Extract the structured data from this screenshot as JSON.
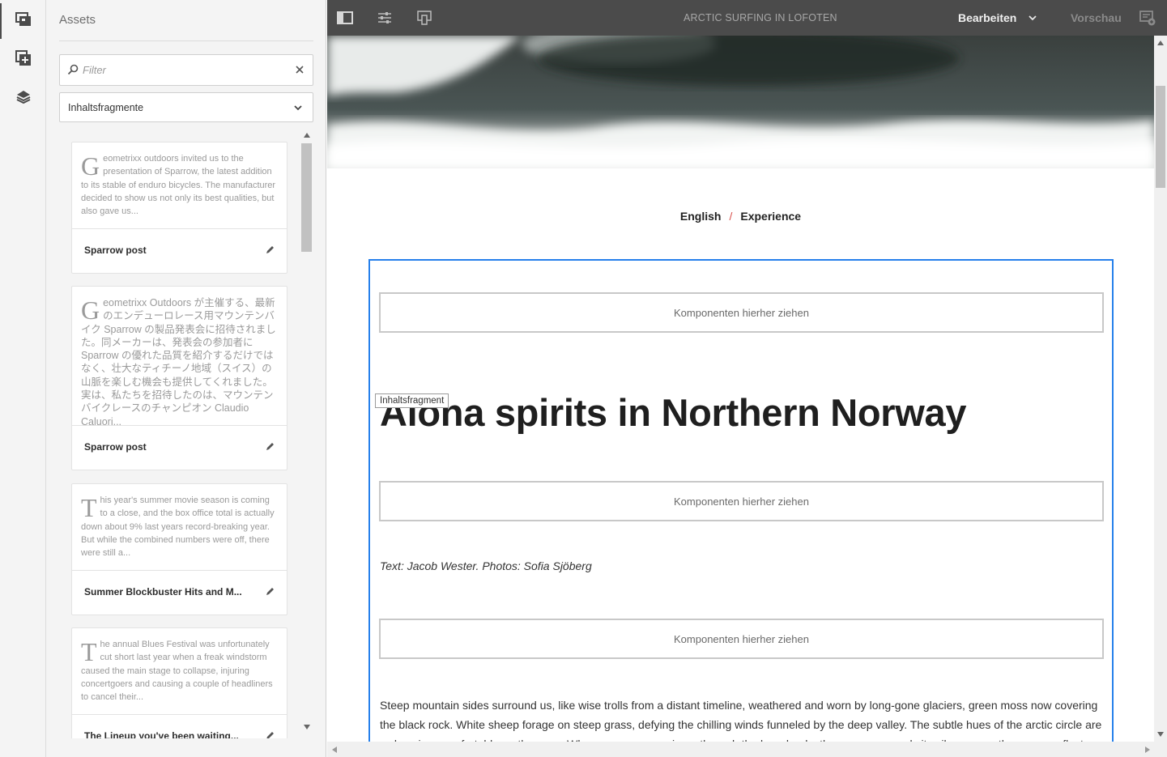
{
  "rail": {
    "items": [
      {
        "icon": "assets-icon"
      },
      {
        "icon": "components-icon"
      },
      {
        "icon": "content-tree-icon"
      }
    ]
  },
  "panel": {
    "title": "Assets",
    "filter_placeholder": "Filter",
    "type_select": "Inhaltsfragmente",
    "cards": [
      {
        "drop": "G",
        "excerpt": "eometrixx outdoors invited us to the presentation of Sparrow, the latest addition to its stable of enduro bicycles. The manufacturer decided to show us not only its best qualities, but also gave us...",
        "title": "Sparrow post"
      },
      {
        "drop": "G",
        "excerpt": "eometrixx Outdoors が主催する、最新のエンデューロレース用マウンテンバイク Sparrow の製品発表会に招待されました。同メーカーは、発表会の参加者に Sparrow の優れた品質を紹介するだけではなく、壮大なティチーノ地域（スイス）の山脈を楽しむ機会も提供してくれました。実は、私たちを招待したのは、マウンテン バイクレースのチャンピオン Claudio Caluori...",
        "title": "Sparrow post"
      },
      {
        "drop": "T",
        "excerpt": "his year's summer movie season is coming to a close, and the box office total is actually down about 9% last years record-breaking year. But while the combined numbers were off, there were still a...",
        "title": "Summer Blockbuster Hits and M..."
      },
      {
        "drop": "T",
        "excerpt": "he annual Blues Festival was unfortunately cut short last year when a freak windstorm caused the main stage to collapse, injuring concertgoers and causing a couple of headliners to cancel their...",
        "title": "The Lineup you've been waiting..."
      }
    ]
  },
  "topbar": {
    "page_title": "ARCTIC SURFING IN LOFOTEN",
    "mode": "Bearbeiten",
    "preview": "Vorschau"
  },
  "page": {
    "breadcrumb": [
      "English",
      "Experience"
    ],
    "breadcrumb_sep": "/",
    "dropzone_label": "Komponenten hierher ziehen",
    "fragment_tag": "Inhaltsfragment",
    "headline": "Aloha spirits in Northern Norway",
    "byline": "Text: Jacob Wester. Photos: Sofia Sjöberg",
    "body": "Steep mountain sides surround us, like wise trolls from a distant timeline, weathered and worn by long-gone glaciers, green moss now covering the black rock. White sheep forage on steep grass, defying the chilling winds funneled by the deep valley. The subtle hues of the arctic circle are welcoming, comfortable on the eyes. When rare sunrays pierce through the low clouds, the scenery reveals its vibrancy, as the waves reflect a"
  },
  "colors": {
    "selection": "#2680eb",
    "topbar": "#4b4b4b",
    "breadcrumb_sep": "#d9534f"
  }
}
